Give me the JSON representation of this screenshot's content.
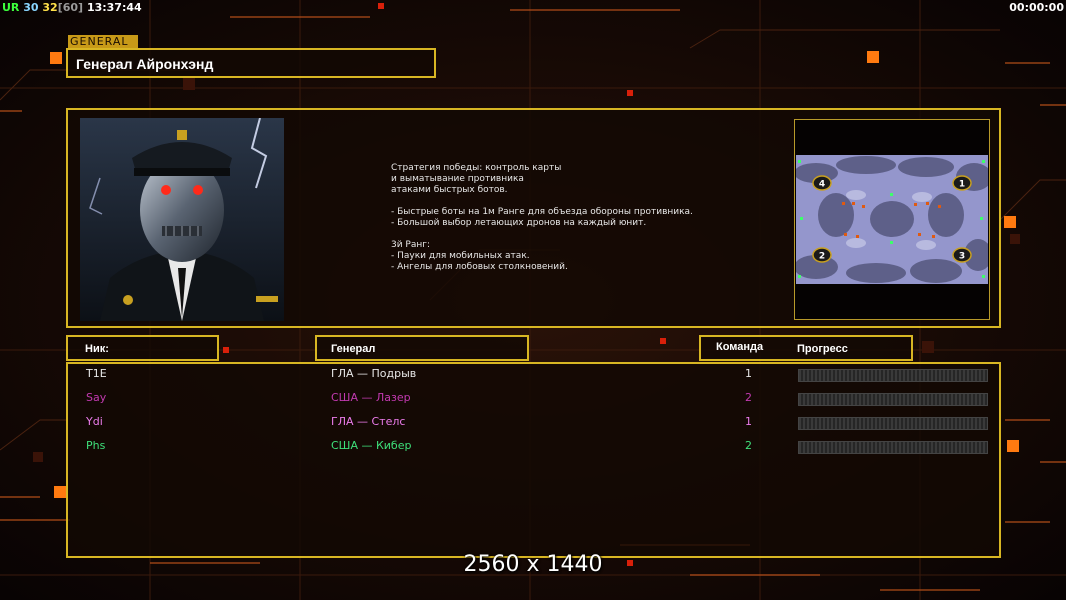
{
  "topbar": {
    "ur_label": "UR",
    "fps_current": "30",
    "fps_second": "32",
    "fps_limit": "[60]",
    "clock": "13:37:44",
    "timer": "00:00:00"
  },
  "general": {
    "tag": "GENERAL",
    "name": "Генерал Айронхэнд",
    "description": "Стратегия победы: контроль карты\nи выматывание противника\nатаками быстрых ботов.\n\n- Быстрые боты на 1м Ранге для объезда обороны противника.\n- Большой выбор летающих дронов на каждый юнит.\n\n3й Ранг:\n- Пауки для мобильных атак.\n- Ангелы для лобовых столкновений."
  },
  "map": {
    "start_positions": [
      "4",
      "1",
      "2",
      "3"
    ]
  },
  "table": {
    "headers": {
      "nick": "Ник:",
      "general": "Генерал",
      "team": "Команда",
      "progress": "Прогресс"
    },
    "rows": [
      {
        "nick": "T1E",
        "general": "ГЛА — Подрыв",
        "team": "1",
        "color": "#e8e8e8",
        "progress": 0
      },
      {
        "nick": "Say",
        "general": "США — Лазер",
        "team": "2",
        "color": "#c23ab0",
        "progress": 0
      },
      {
        "nick": "Ydi",
        "general": "ГЛА — Стелс",
        "team": "1",
        "color": "#ec7cec",
        "progress": 0
      },
      {
        "nick": "Phs",
        "general": "США — Кибер",
        "team": "2",
        "color": "#3ee07a",
        "progress": 0
      }
    ]
  },
  "resolution_label": "2560 x 1440",
  "colors": {
    "frame": "#d8b623",
    "accent_orange": "#ff7a10"
  }
}
